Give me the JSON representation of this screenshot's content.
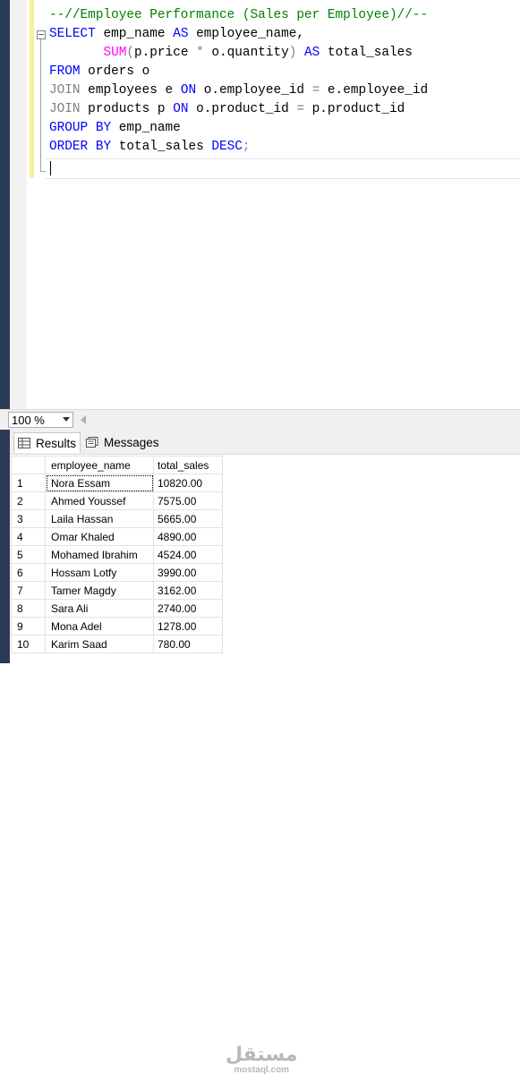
{
  "editor": {
    "lines": [
      [
        {
          "t": "--//Employee Performance (Sales per Employee)//--",
          "c": "cm"
        }
      ],
      [
        {
          "t": "SELECT",
          "c": "kw"
        },
        {
          "t": " emp_name ",
          "c": "id"
        },
        {
          "t": "AS",
          "c": "kw"
        },
        {
          "t": " employee_name,",
          "c": "id"
        }
      ],
      [
        {
          "t": "       ",
          "c": "id"
        },
        {
          "t": "SUM",
          "c": "fn"
        },
        {
          "t": "(",
          "c": "gr"
        },
        {
          "t": "p.price ",
          "c": "id"
        },
        {
          "t": "*",
          "c": "gr"
        },
        {
          "t": " o.quantity",
          "c": "id"
        },
        {
          "t": ")",
          "c": "gr"
        },
        {
          "t": " ",
          "c": "id"
        },
        {
          "t": "AS",
          "c": "kw"
        },
        {
          "t": " total_sales",
          "c": "id"
        }
      ],
      [
        {
          "t": "FROM",
          "c": "kw"
        },
        {
          "t": " orders o",
          "c": "id"
        }
      ],
      [
        {
          "t": "JOIN",
          "c": "gr"
        },
        {
          "t": " employees e ",
          "c": "id"
        },
        {
          "t": "ON",
          "c": "kw"
        },
        {
          "t": " o.employee_id ",
          "c": "id"
        },
        {
          "t": "=",
          "c": "gr"
        },
        {
          "t": " e.employee_id",
          "c": "id"
        }
      ],
      [
        {
          "t": "JOIN",
          "c": "gr"
        },
        {
          "t": " products p ",
          "c": "id"
        },
        {
          "t": "ON",
          "c": "kw"
        },
        {
          "t": " o.product_id ",
          "c": "id"
        },
        {
          "t": "=",
          "c": "gr"
        },
        {
          "t": " p.product_id",
          "c": "id"
        }
      ],
      [
        {
          "t": "GROUP BY",
          "c": "kw"
        },
        {
          "t": " emp_name",
          "c": "id"
        }
      ],
      [
        {
          "t": "ORDER BY",
          "c": "kw"
        },
        {
          "t": " total_sales ",
          "c": "id"
        },
        {
          "t": "DESC",
          "c": "kw"
        },
        {
          "t": ";",
          "c": "gr"
        }
      ]
    ]
  },
  "zoom": {
    "value": "100 %"
  },
  "tabs": {
    "results": "Results",
    "messages": "Messages"
  },
  "grid": {
    "columns": [
      "employee_name",
      "total_sales"
    ],
    "rows": [
      [
        "1",
        "Nora Essam",
        "10820.00"
      ],
      [
        "2",
        "Ahmed Youssef",
        "7575.00"
      ],
      [
        "3",
        "Laila Hassan",
        "5665.00"
      ],
      [
        "4",
        "Omar Khaled",
        "4890.00"
      ],
      [
        "5",
        "Mohamed Ibrahim",
        "4524.00"
      ],
      [
        "6",
        "Hossam Lotfy",
        "3990.00"
      ],
      [
        "7",
        "Tamer Magdy",
        "3162.00"
      ],
      [
        "8",
        "Sara Ali",
        "2740.00"
      ],
      [
        "9",
        "Mona Adel",
        "1278.00"
      ],
      [
        "10",
        "Karim Saad",
        "780.00"
      ]
    ]
  },
  "watermark": {
    "logo": "مستقل",
    "url": "mostaql.com"
  }
}
